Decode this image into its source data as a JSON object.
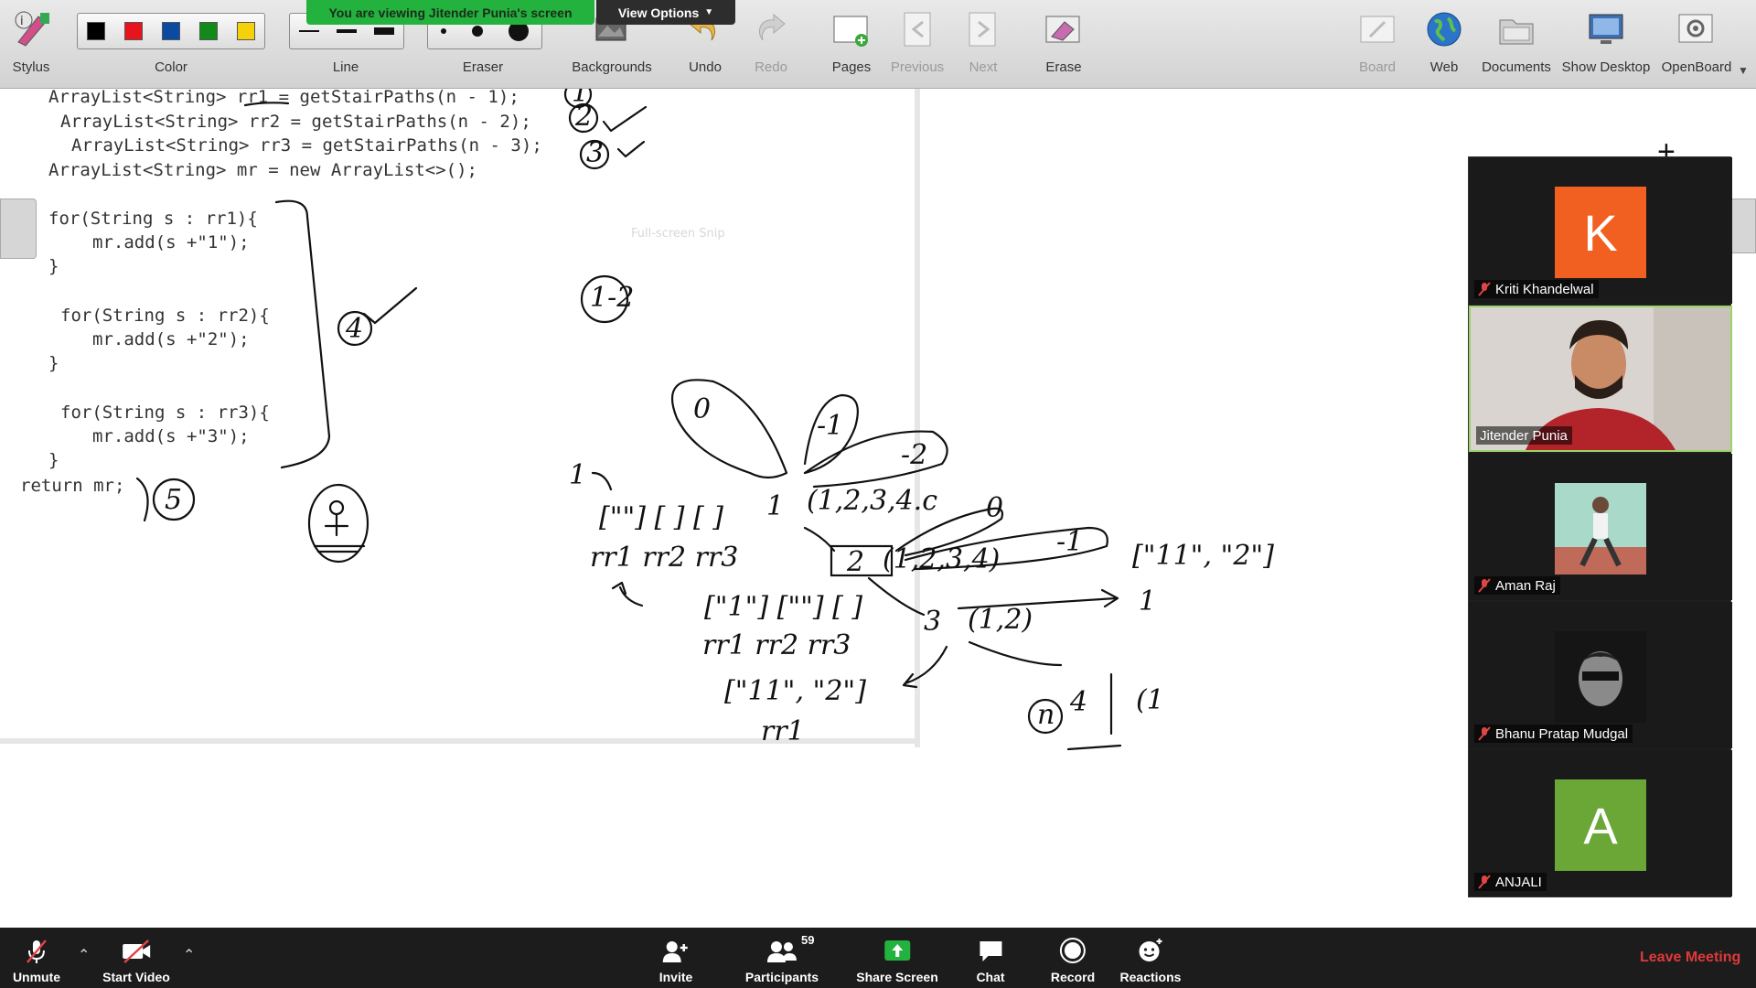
{
  "share_banner": {
    "text": "You are viewing Jitender Punia's screen",
    "view_options": "View Options"
  },
  "toolbar": {
    "stylus": "Stylus",
    "color": "Color",
    "line": "Line",
    "eraser": "Eraser",
    "backgrounds": "Backgrounds",
    "undo": "Undo",
    "redo": "Redo",
    "pages": "Pages",
    "previous": "Previous",
    "next": "Next",
    "erase": "Erase",
    "board": "Board",
    "web": "Web",
    "documents": "Documents",
    "show_desktop": "Show Desktop",
    "openboard": "OpenBoard",
    "colors": [
      "#000000",
      "#e8141d",
      "#0a4aa0",
      "#118a1a",
      "#f4d10a"
    ]
  },
  "board": {
    "code_lines": [
      "ArrayList<String> rr1 = getStairPaths(n - 1);",
      "ArrayList<String> rr2 = getStairPaths(n - 2);",
      "ArrayList<String> rr3 = getStairPaths(n - 3);",
      "ArrayList<String> mr = new ArrayList<>();",
      "for(String s : rr1){",
      "mr.add(s +\"1\");",
      "}",
      "for(String s : rr2){",
      "mr.add(s +\"2\");",
      "}",
      "for(String s : rr3){",
      "mr.add(s +\"3\");",
      "}",
      "return mr;"
    ],
    "ghost_text": "Full-screen Snip",
    "handwriting": {
      "n1": "1",
      "n2": "2",
      "n3": "3",
      "n4": "4",
      "n5": "5",
      "one_minus_two": "1-2",
      "minus1": "-1",
      "minus2": "-2",
      "zero": "0",
      "top_calls": "(1,2,3,4.c",
      "mid_calls": "(1,2,3,4)",
      "low_calls": "(1,2)",
      "lists_top": "[\"\"] [ ] [ ]",
      "labels_top": "rr1  rr2  rr3",
      "lists_mid": "[\"1\"] [\"\"] [ ]",
      "labels_mid": "rr1  rr2  rr3",
      "result_small": "[\"11\", \"2\"]",
      "result_right": "[\"11\", \"2\"]",
      "label_rr1": "rr1",
      "n_circle": "n",
      "arrow_target": "1",
      "partial": "(1",
      "level_one": "1",
      "left_one": "1"
    }
  },
  "participants": [
    {
      "name": "Kriti Khandelwal",
      "initial": "K",
      "color": "#f26021",
      "muted": true,
      "type": "avatar"
    },
    {
      "name": "Jitender Punia",
      "muted": false,
      "type": "video",
      "active": true
    },
    {
      "name": "Aman Raj",
      "muted": true,
      "type": "photo"
    },
    {
      "name": "Bhanu Pratap Mudgal",
      "muted": true,
      "type": "photo"
    },
    {
      "name": "ANJALI",
      "initial": "A",
      "color": "#6aa737",
      "muted": true,
      "type": "avatar"
    }
  ],
  "controls": {
    "unmute": "Unmute",
    "start_video": "Start Video",
    "invite": "Invite",
    "participants": "Participants",
    "participants_count": "59",
    "share_screen": "Share Screen",
    "chat": "Chat",
    "record": "Record",
    "reactions": "Reactions",
    "leave": "Leave Meeting"
  }
}
